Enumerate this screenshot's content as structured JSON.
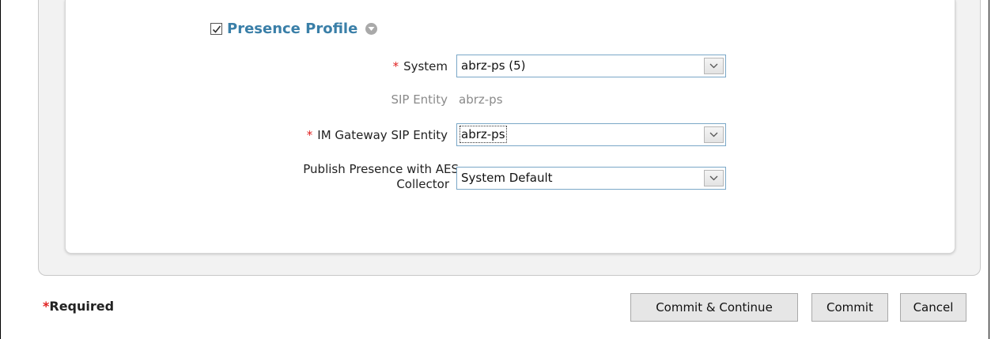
{
  "profile": {
    "title": "Presence Profile",
    "checked": true
  },
  "fields": {
    "system": {
      "required": "*",
      "label": "System",
      "value": "abrz-ps (5)"
    },
    "sip_entity": {
      "label": "SIP Entity",
      "value": "abrz-ps"
    },
    "im_gateway": {
      "required": "*",
      "label": "IM Gateway SIP Entity",
      "value": "abrz-ps"
    },
    "publish_presence": {
      "label_line1": "Publish Presence with AES",
      "label_line2": "Collector",
      "value": "System Default"
    }
  },
  "footer": {
    "required_star": "*",
    "required_text": "Required",
    "commit_continue_label": "Commit & Continue",
    "commit_label": "Commit",
    "cancel_label": "Cancel"
  },
  "colors": {
    "title": "#3a7fa8",
    "required": "#e02020"
  }
}
